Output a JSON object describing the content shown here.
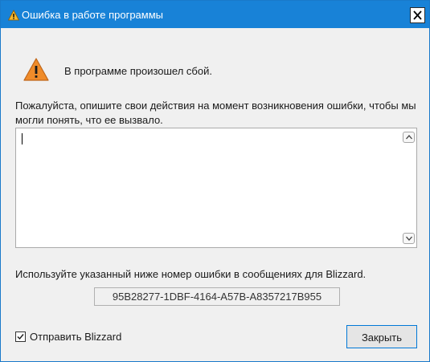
{
  "window": {
    "title": "Ошибка в работе программы",
    "title_icon": "warning-icon",
    "close_icon": "close-icon"
  },
  "dialog": {
    "message": "В программе произошел сбой.",
    "prompt": "Пожалуйста, опишите свои действия на момент возникновения ошибки, чтобы мы могли понять, что ее вызвало.",
    "description_value": "",
    "note": "Используйте указанный ниже номер ошибки в сообщениях для Blizzard.",
    "error_code": "95B28277-1DBF-4164-A57B-A8357217B955",
    "send_label": "Отправить Blizzard",
    "send_checked": true,
    "close_label": "Закрыть"
  },
  "colors": {
    "titlebar": "#1882d7",
    "warning_fill": "#f08c2a",
    "button_border": "#0078d7"
  }
}
